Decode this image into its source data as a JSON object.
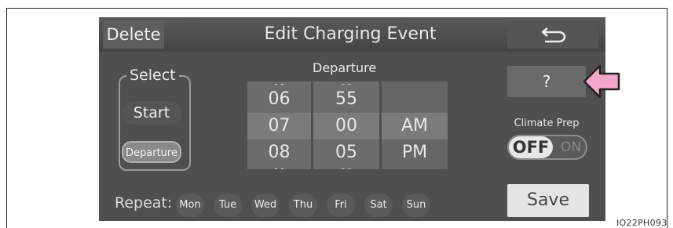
{
  "topbar": {
    "delete_label": "Delete",
    "title": "Edit Charging Event"
  },
  "form": {
    "section_label": "Departure",
    "select_label": "Select",
    "start_label": "Start",
    "departure_label": "Departure"
  },
  "picker": {
    "hours": {
      "above": "06",
      "selected": "07",
      "below": "08"
    },
    "minutes": {
      "above": "55",
      "selected": "00",
      "below": "05"
    },
    "ampm": {
      "selected": "AM",
      "below": "PM"
    }
  },
  "right_panel": {
    "help_label": "?",
    "climate_label": "Climate Prep",
    "toggle_off": "OFF",
    "toggle_on": "ON",
    "save_label": "Save"
  },
  "repeat": {
    "label": "Repeat:",
    "days": [
      "Mon",
      "Tue",
      "Wed",
      "Thu",
      "Fri",
      "Sat",
      "Sun"
    ]
  },
  "image_code": "IO22PH093",
  "colors": {
    "screen_bg": "#4f4f4f",
    "picker_bg": "#6c6c6c",
    "arrow_fill": "#f2a8c8"
  }
}
